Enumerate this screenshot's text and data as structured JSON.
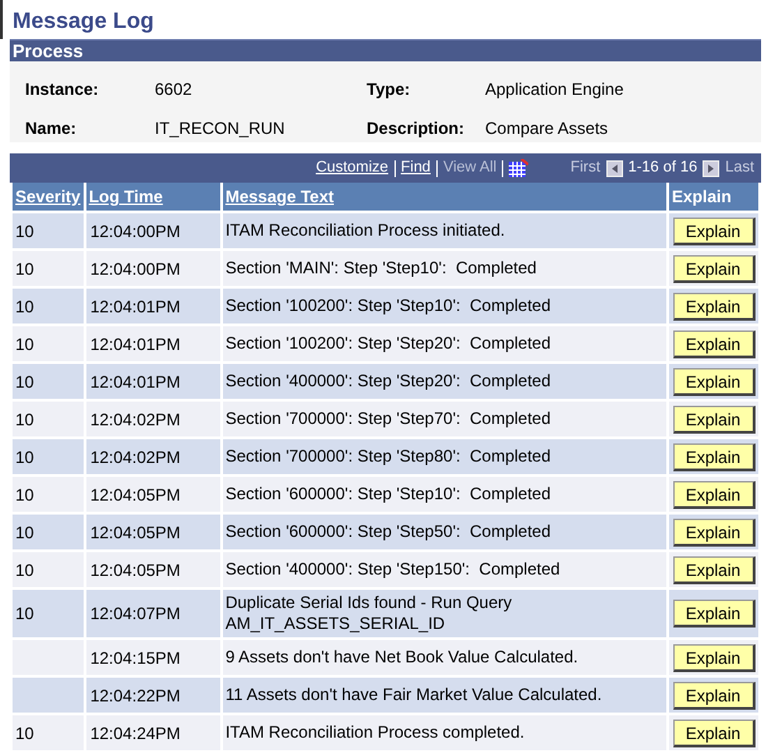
{
  "page_title": "Message Log",
  "process": {
    "title": "Process",
    "fields": [
      {
        "label": "Instance:",
        "value": "6602"
      },
      {
        "label": "Type:",
        "value": "Application Engine"
      },
      {
        "label": "Name:",
        "value": "IT_RECON_RUN"
      },
      {
        "label": "Description:",
        "value": "Compare Assets"
      }
    ]
  },
  "grid": {
    "toolbar": {
      "links": [
        {
          "label": "Customize",
          "disabled": false
        },
        {
          "label": "Find",
          "disabled": false
        },
        {
          "label": "View All",
          "disabled": true
        }
      ],
      "first": "First",
      "range": "1-16 of 16",
      "last": "Last"
    },
    "columns": [
      "Severity",
      "Log Time",
      "Message Text",
      "Explain"
    ],
    "rows": [
      {
        "severity": "10",
        "time": "12:04:00PM",
        "message": "ITAM Reconciliation Process initiated.",
        "button": "Explain"
      },
      {
        "severity": "10",
        "time": "12:04:00PM",
        "message": "Section 'MAIN': Step 'Step10':  Completed",
        "button": "Explain"
      },
      {
        "severity": "10",
        "time": "12:04:01PM",
        "message": "Section '100200': Step 'Step10':  Completed",
        "button": "Explain"
      },
      {
        "severity": "10",
        "time": "12:04:01PM",
        "message": "Section '100200': Step 'Step20':  Completed",
        "button": "Explain"
      },
      {
        "severity": "10",
        "time": "12:04:01PM",
        "message": "Section '400000': Step 'Step20':  Completed",
        "button": "Explain"
      },
      {
        "severity": "10",
        "time": "12:04:02PM",
        "message": "Section '700000': Step 'Step70':  Completed",
        "button": "Explain"
      },
      {
        "severity": "10",
        "time": "12:04:02PM",
        "message": "Section '700000': Step 'Step80':  Completed",
        "button": "Explain"
      },
      {
        "severity": "10",
        "time": "12:04:05PM",
        "message": "Section '600000': Step 'Step10':  Completed",
        "button": "Explain"
      },
      {
        "severity": "10",
        "time": "12:04:05PM",
        "message": "Section '600000': Step 'Step50':  Completed",
        "button": "Explain"
      },
      {
        "severity": "10",
        "time": "12:04:05PM",
        "message": "Section '400000': Step 'Step150':  Completed",
        "button": "Explain"
      },
      {
        "severity": "10",
        "time": "12:04:07PM",
        "message": "Duplicate Serial Ids found - Run Query AM_IT_ASSETS_SERIAL_ID",
        "button": "Explain"
      },
      {
        "time": "12:04:15PM",
        "message": "9 Assets don't have Net Book Value Calculated.",
        "button": "Explain"
      },
      {
        "time": "12:04:22PM",
        "message": "11 Assets don't have Fair Market Value Calculated.",
        "button": "Explain"
      },
      {
        "severity": "10",
        "time": "12:04:24PM",
        "message": "ITAM Reconciliation Process completed.",
        "button": "Explain"
      }
    ]
  }
}
